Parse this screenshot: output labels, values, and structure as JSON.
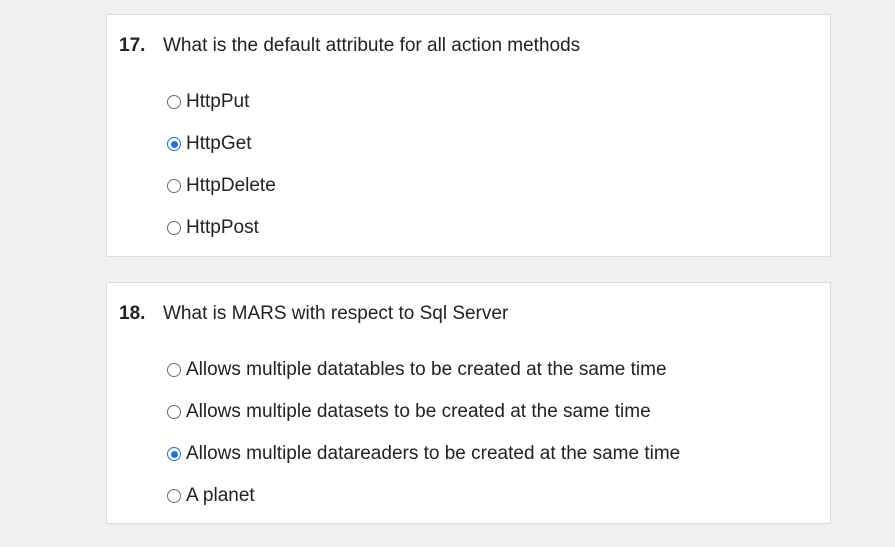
{
  "accent_color": "#1a73e8",
  "questions": [
    {
      "number": "17.",
      "text": "What is the default attribute for all action methods",
      "options": [
        {
          "label": "HttpPut",
          "selected": false
        },
        {
          "label": "HttpGet",
          "selected": true
        },
        {
          "label": "HttpDelete",
          "selected": false
        },
        {
          "label": "HttpPost",
          "selected": false
        }
      ]
    },
    {
      "number": "18.",
      "text": "What is MARS with respect to Sql Server",
      "options": [
        {
          "label": "Allows multiple datatables to be created at the same time",
          "selected": false
        },
        {
          "label": "Allows multiple datasets to be created at the same time",
          "selected": false
        },
        {
          "label": "Allows multiple datareaders to be created at the same time",
          "selected": true
        },
        {
          "label": "A planet",
          "selected": false
        }
      ]
    }
  ]
}
